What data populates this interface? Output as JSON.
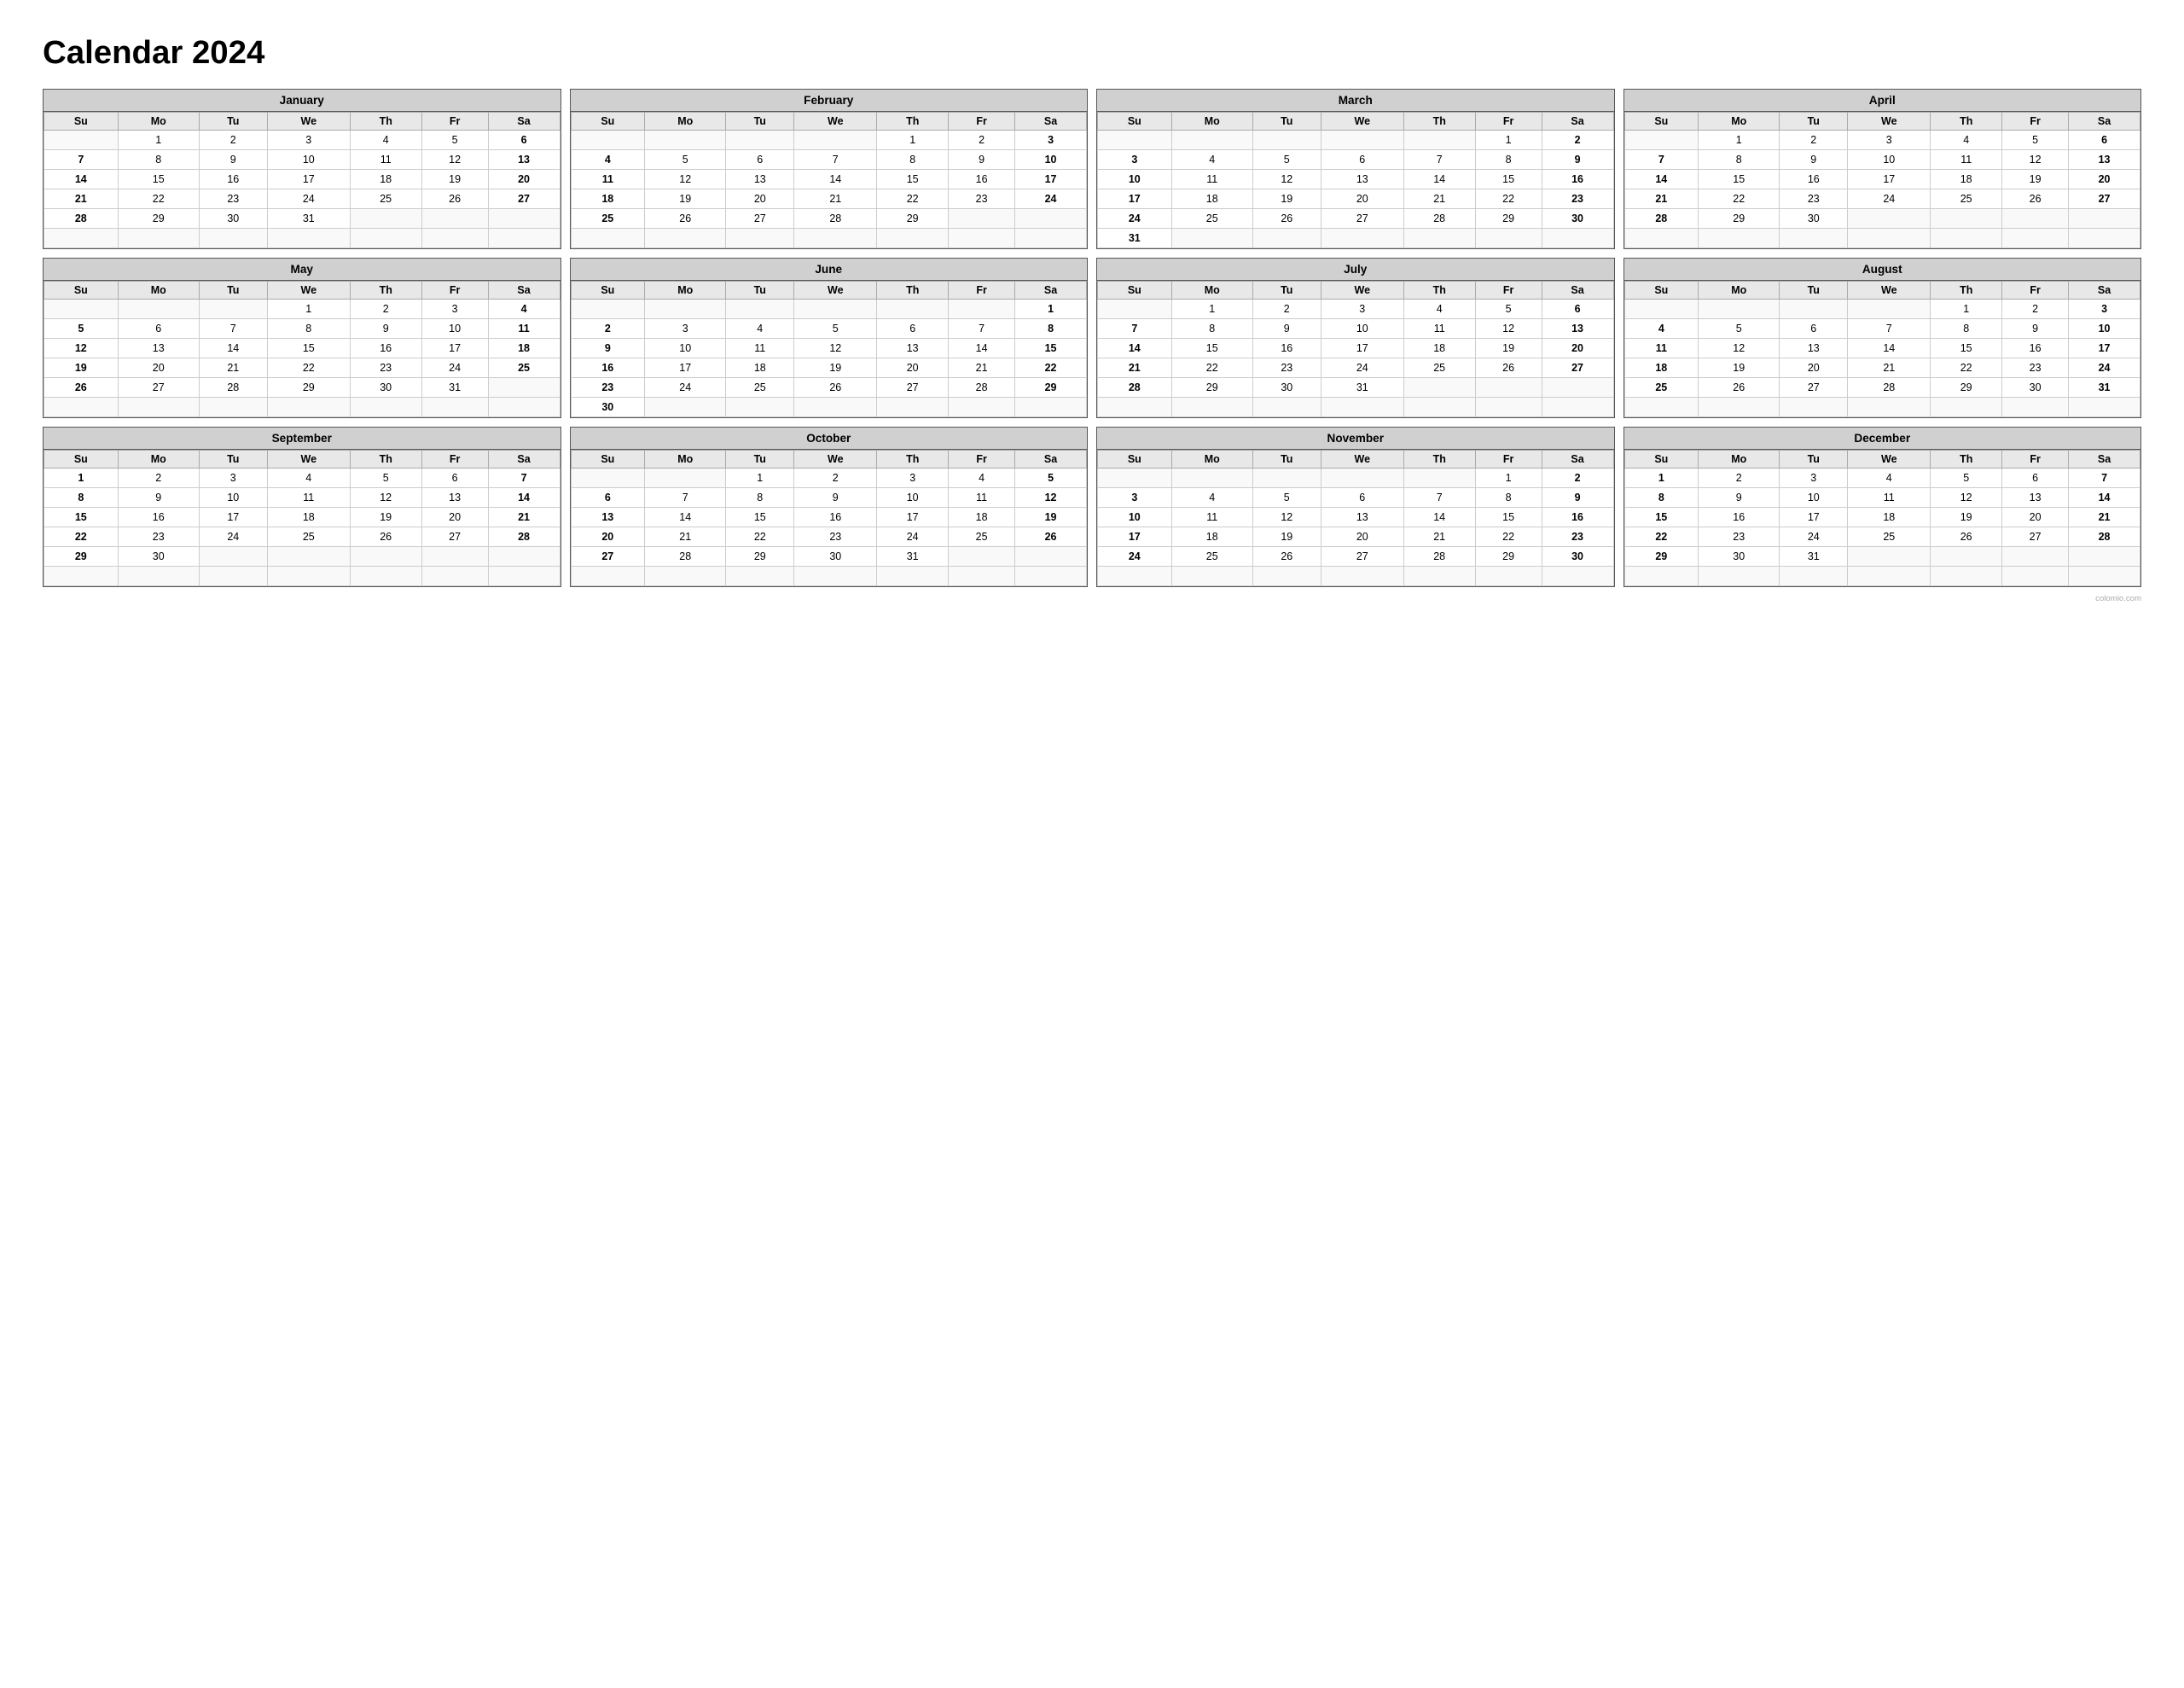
{
  "title": "Calendar 2024",
  "watermark": "colomio.com",
  "days_header": [
    "Su",
    "Mo",
    "Tu",
    "We",
    "Th",
    "Fr",
    "Sa"
  ],
  "months": [
    {
      "name": "January",
      "weeks": [
        [
          "",
          "1",
          "2",
          "3",
          "4",
          "5",
          "6"
        ],
        [
          "7",
          "8",
          "9",
          "10",
          "11",
          "12",
          "13"
        ],
        [
          "14",
          "15",
          "16",
          "17",
          "18",
          "19",
          "20"
        ],
        [
          "21",
          "22",
          "23",
          "24",
          "25",
          "26",
          "27"
        ],
        [
          "28",
          "29",
          "30",
          "31",
          "",
          "",
          ""
        ]
      ]
    },
    {
      "name": "February",
      "weeks": [
        [
          "",
          "",
          "",
          "",
          "1",
          "2",
          "3"
        ],
        [
          "4",
          "5",
          "6",
          "7",
          "8",
          "9",
          "10"
        ],
        [
          "11",
          "12",
          "13",
          "14",
          "15",
          "16",
          "17"
        ],
        [
          "18",
          "19",
          "20",
          "21",
          "22",
          "23",
          "24"
        ],
        [
          "25",
          "26",
          "27",
          "28",
          "29",
          "",
          ""
        ]
      ]
    },
    {
      "name": "March",
      "weeks": [
        [
          "",
          "",
          "",
          "",
          "",
          "1",
          "2"
        ],
        [
          "3",
          "4",
          "5",
          "6",
          "7",
          "8",
          "9"
        ],
        [
          "10",
          "11",
          "12",
          "13",
          "14",
          "15",
          "16"
        ],
        [
          "17",
          "18",
          "19",
          "20",
          "21",
          "22",
          "23"
        ],
        [
          "24",
          "25",
          "26",
          "27",
          "28",
          "29",
          "30"
        ],
        [
          "31",
          "",
          "",
          "",
          "",
          "",
          ""
        ]
      ]
    },
    {
      "name": "April",
      "weeks": [
        [
          "",
          "1",
          "2",
          "3",
          "4",
          "5",
          "6"
        ],
        [
          "7",
          "8",
          "9",
          "10",
          "11",
          "12",
          "13"
        ],
        [
          "14",
          "15",
          "16",
          "17",
          "18",
          "19",
          "20"
        ],
        [
          "21",
          "22",
          "23",
          "24",
          "25",
          "26",
          "27"
        ],
        [
          "28",
          "29",
          "30",
          "",
          "",
          "",
          ""
        ]
      ]
    },
    {
      "name": "May",
      "weeks": [
        [
          "",
          "",
          "",
          "1",
          "2",
          "3",
          "4"
        ],
        [
          "5",
          "6",
          "7",
          "8",
          "9",
          "10",
          "11"
        ],
        [
          "12",
          "13",
          "14",
          "15",
          "16",
          "17",
          "18"
        ],
        [
          "19",
          "20",
          "21",
          "22",
          "23",
          "24",
          "25"
        ],
        [
          "26",
          "27",
          "28",
          "29",
          "30",
          "31",
          ""
        ]
      ]
    },
    {
      "name": "June",
      "weeks": [
        [
          "",
          "",
          "",
          "",
          "",
          "",
          "1"
        ],
        [
          "2",
          "3",
          "4",
          "5",
          "6",
          "7",
          "8"
        ],
        [
          "9",
          "10",
          "11",
          "12",
          "13",
          "14",
          "15"
        ],
        [
          "16",
          "17",
          "18",
          "19",
          "20",
          "21",
          "22"
        ],
        [
          "23",
          "24",
          "25",
          "26",
          "27",
          "28",
          "29"
        ],
        [
          "30",
          "",
          "",
          "",
          "",
          "",
          ""
        ]
      ]
    },
    {
      "name": "July",
      "weeks": [
        [
          "",
          "1",
          "2",
          "3",
          "4",
          "5",
          "6"
        ],
        [
          "7",
          "8",
          "9",
          "10",
          "11",
          "12",
          "13"
        ],
        [
          "14",
          "15",
          "16",
          "17",
          "18",
          "19",
          "20"
        ],
        [
          "21",
          "22",
          "23",
          "24",
          "25",
          "26",
          "27"
        ],
        [
          "28",
          "29",
          "30",
          "31",
          "",
          "",
          ""
        ]
      ]
    },
    {
      "name": "August",
      "weeks": [
        [
          "",
          "",
          "",
          "",
          "1",
          "2",
          "3"
        ],
        [
          "4",
          "5",
          "6",
          "7",
          "8",
          "9",
          "10"
        ],
        [
          "11",
          "12",
          "13",
          "14",
          "15",
          "16",
          "17"
        ],
        [
          "18",
          "19",
          "20",
          "21",
          "22",
          "23",
          "24"
        ],
        [
          "25",
          "26",
          "27",
          "28",
          "29",
          "30",
          "31"
        ]
      ]
    },
    {
      "name": "September",
      "weeks": [
        [
          "1",
          "2",
          "3",
          "4",
          "5",
          "6",
          "7"
        ],
        [
          "8",
          "9",
          "10",
          "11",
          "12",
          "13",
          "14"
        ],
        [
          "15",
          "16",
          "17",
          "18",
          "19",
          "20",
          "21"
        ],
        [
          "22",
          "23",
          "24",
          "25",
          "26",
          "27",
          "28"
        ],
        [
          "29",
          "30",
          "",
          "",
          "",
          "",
          ""
        ]
      ]
    },
    {
      "name": "October",
      "weeks": [
        [
          "",
          "",
          "1",
          "2",
          "3",
          "4",
          "5"
        ],
        [
          "6",
          "7",
          "8",
          "9",
          "10",
          "11",
          "12"
        ],
        [
          "13",
          "14",
          "15",
          "16",
          "17",
          "18",
          "19"
        ],
        [
          "20",
          "21",
          "22",
          "23",
          "24",
          "25",
          "26"
        ],
        [
          "27",
          "28",
          "29",
          "30",
          "31",
          "",
          ""
        ]
      ]
    },
    {
      "name": "November",
      "weeks": [
        [
          "",
          "",
          "",
          "",
          "",
          "1",
          "2"
        ],
        [
          "3",
          "4",
          "5",
          "6",
          "7",
          "8",
          "9"
        ],
        [
          "10",
          "11",
          "12",
          "13",
          "14",
          "15",
          "16"
        ],
        [
          "17",
          "18",
          "19",
          "20",
          "21",
          "22",
          "23"
        ],
        [
          "24",
          "25",
          "26",
          "27",
          "28",
          "29",
          "30"
        ]
      ]
    },
    {
      "name": "December",
      "weeks": [
        [
          "1",
          "2",
          "3",
          "4",
          "5",
          "6",
          "7"
        ],
        [
          "8",
          "9",
          "10",
          "11",
          "12",
          "13",
          "14"
        ],
        [
          "15",
          "16",
          "17",
          "18",
          "19",
          "20",
          "21"
        ],
        [
          "22",
          "23",
          "24",
          "25",
          "26",
          "27",
          "28"
        ],
        [
          "29",
          "30",
          "31",
          "",
          "",
          "",
          ""
        ]
      ]
    }
  ]
}
